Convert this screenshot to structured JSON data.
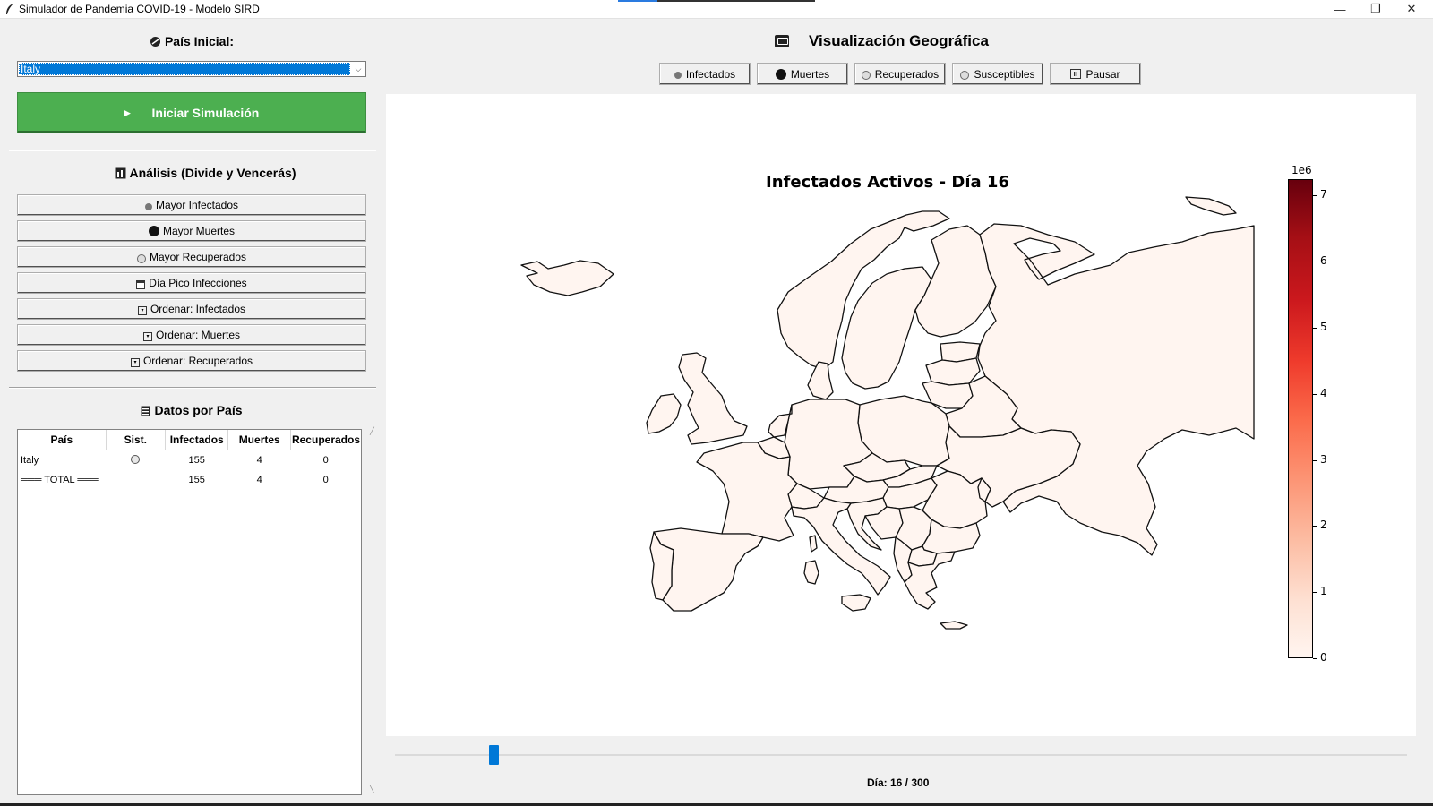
{
  "window": {
    "title": "Simulador de Pandemia COVID-19 - Modelo SIRD",
    "controls": {
      "minimize": "—",
      "maximize": "❐",
      "close": "✕"
    }
  },
  "left": {
    "country_title": "País Inicial:",
    "country_value": "Italy",
    "start_button": "Iniciar Simulación",
    "analysis_title": "Análisis (Divide y Vencerás)",
    "analysis_buttons": [
      {
        "label": "Mayor Infectados",
        "icon": "gray-dot-icon"
      },
      {
        "label": "Mayor Muertes",
        "icon": "black-dot-icon"
      },
      {
        "label": "Mayor Recuperados",
        "icon": "light-dot-icon"
      },
      {
        "label": "Día Pico Infecciones",
        "icon": "calendar-icon"
      },
      {
        "label": "Ordenar: Infectados",
        "icon": "sort-icon"
      },
      {
        "label": "Ordenar: Muertes",
        "icon": "sort-icon"
      },
      {
        "label": "Ordenar: Recuperados",
        "icon": "sort-icon"
      }
    ],
    "table_title": "Datos por País",
    "table": {
      "headers": [
        "País",
        "Sist.",
        "Infectados",
        "Muertes",
        "Recuperados"
      ],
      "rows": [
        {
          "pais": "Italy",
          "sist": "",
          "infectados": "155",
          "muertes": "4",
          "recuperados": "0"
        },
        {
          "pais": "═══ TOTAL ═══",
          "sist": "",
          "infectados": "155",
          "muertes": "4",
          "recuperados": "0"
        }
      ]
    }
  },
  "right": {
    "viz_title": "Visualización Geográfica",
    "view_buttons": [
      {
        "label": "Infectados",
        "icon": "gray-dot-icon"
      },
      {
        "label": "Muertes",
        "icon": "black-dot-icon"
      },
      {
        "label": "Recuperados",
        "icon": "light-dot-icon"
      },
      {
        "label": "Susceptibles",
        "icon": "light-dot-icon"
      },
      {
        "label": "Pausar",
        "icon": "pause-icon"
      }
    ],
    "map_title": "Infectados Activos - Día 16",
    "colorbar": {
      "exponent": "1e6",
      "ticks": [
        "0",
        "1",
        "2",
        "3",
        "4",
        "5",
        "6",
        "7"
      ],
      "colors": [
        "#fff5f0",
        "#67000d"
      ]
    },
    "slider": {
      "day": 16,
      "max": 300
    },
    "day_label": "Día: 16 / 300"
  },
  "colors": {
    "start_green": "#4caf50",
    "selection_blue": "#0078d7",
    "map_fill": "#fff5f0"
  }
}
